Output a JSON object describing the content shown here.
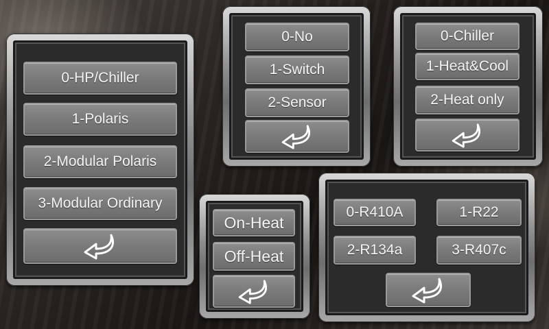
{
  "panel_hp_type": {
    "options": [
      "0-HP/Chiller",
      "1-Polaris",
      "2-Modular Polaris",
      "3-Modular Ordinary"
    ],
    "back_icon": "return-arrow-icon"
  },
  "panel_switch": {
    "options": [
      "0-No",
      "1-Switch",
      "2-Sensor"
    ],
    "back_icon": "return-arrow-icon"
  },
  "panel_mode": {
    "options": [
      "0-Chiller",
      "1-Heat&Cool",
      "2-Heat only"
    ],
    "back_icon": "return-arrow-icon"
  },
  "panel_heat": {
    "options": [
      "On-Heat",
      "Off-Heat"
    ],
    "back_icon": "return-arrow-icon"
  },
  "panel_refrigerant": {
    "options": [
      "0-R410A",
      "1-R22",
      "2-R134a",
      "3-R407c"
    ],
    "back_icon": "return-arrow-icon"
  }
}
